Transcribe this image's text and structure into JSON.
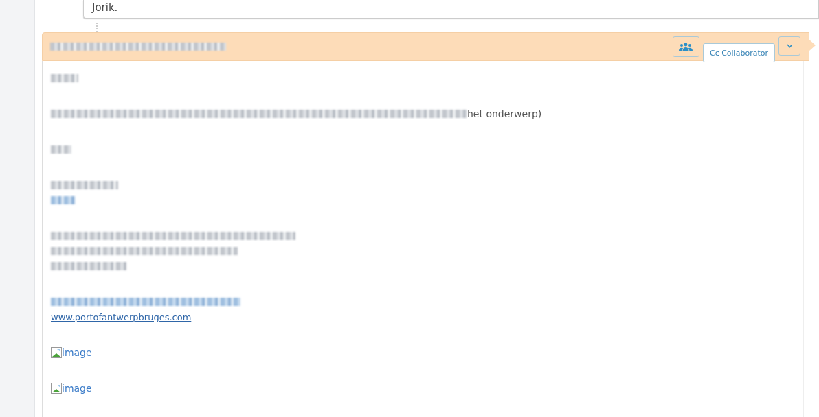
{
  "previous_message": {
    "text": "Jorik."
  },
  "message": {
    "header": {
      "title": {
        "kind": "redacted"
      }
    },
    "buttons": [
      {
        "kind": "collaborators"
      },
      {
        "kind": "cc",
        "label": "Cc Collaborator"
      },
      {
        "kind": "menu"
      }
    ],
    "paragraphs": [
      [
        [
          {
            "kind": "redacted"
          }
        ]
      ],
      [
        [
          {
            "kind": "redacted"
          },
          {
            "kind": "text",
            "text": "het onderwerp)"
          }
        ]
      ],
      [
        [
          {
            "kind": "redacted"
          }
        ]
      ],
      [
        [
          {
            "kind": "redacted"
          }
        ],
        [
          {
            "kind": "redacted-link"
          }
        ]
      ],
      [
        [
          {
            "kind": "redacted"
          }
        ],
        [
          {
            "kind": "redacted"
          }
        ],
        [
          {
            "kind": "redacted"
          }
        ]
      ],
      [
        [
          {
            "kind": "redacted-link"
          }
        ],
        [
          {
            "kind": "link",
            "text": "www.portofantwerpbruges.com"
          }
        ]
      ],
      [
        [
          {
            "kind": "image",
            "alt": "image"
          }
        ]
      ],
      [
        [
          {
            "kind": "image",
            "alt": "image"
          }
        ]
      ]
    ]
  }
}
